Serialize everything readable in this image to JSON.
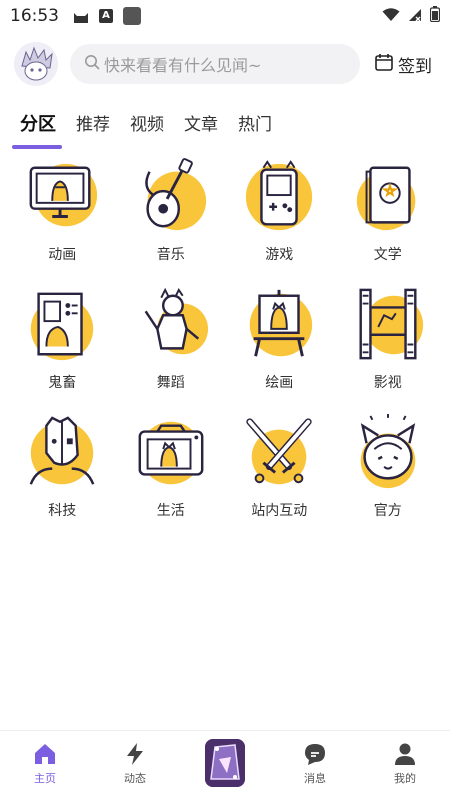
{
  "status_bar": {
    "time": "16:53"
  },
  "header": {
    "search_placeholder": "快来看看有什么见闻~",
    "checkin_label": "签到"
  },
  "tabs": [
    {
      "label": "分区",
      "active": true
    },
    {
      "label": "推荐"
    },
    {
      "label": "视频"
    },
    {
      "label": "文章"
    },
    {
      "label": "热门"
    }
  ],
  "categories": [
    {
      "label": "动画",
      "icon": "monitor-girl-icon"
    },
    {
      "label": "音乐",
      "icon": "guitar-icon"
    },
    {
      "label": "游戏",
      "icon": "gameboy-icon"
    },
    {
      "label": "文学",
      "icon": "book-icon"
    },
    {
      "label": "鬼畜",
      "icon": "poster-icon"
    },
    {
      "label": "舞蹈",
      "icon": "dancer-icon"
    },
    {
      "label": "绘画",
      "icon": "easel-icon"
    },
    {
      "label": "影视",
      "icon": "film-icon"
    },
    {
      "label": "科技",
      "icon": "robot-face-icon"
    },
    {
      "label": "生活",
      "icon": "camera-icon"
    },
    {
      "label": "站内互动",
      "icon": "crossed-swords-icon"
    },
    {
      "label": "官方",
      "icon": "cat-girl-icon"
    }
  ],
  "bottom_nav": [
    {
      "label": "主页",
      "icon": "home-icon",
      "active": true
    },
    {
      "label": "动态",
      "icon": "lightning-icon"
    },
    {
      "label": "",
      "icon": "center-avatar-icon"
    },
    {
      "label": "消息",
      "icon": "message-icon"
    },
    {
      "label": "我的",
      "icon": "profile-icon"
    }
  ],
  "colors": {
    "accent": "#7b5fe0",
    "icon_yellow": "#f9c53b",
    "icon_line": "#2b2440"
  }
}
